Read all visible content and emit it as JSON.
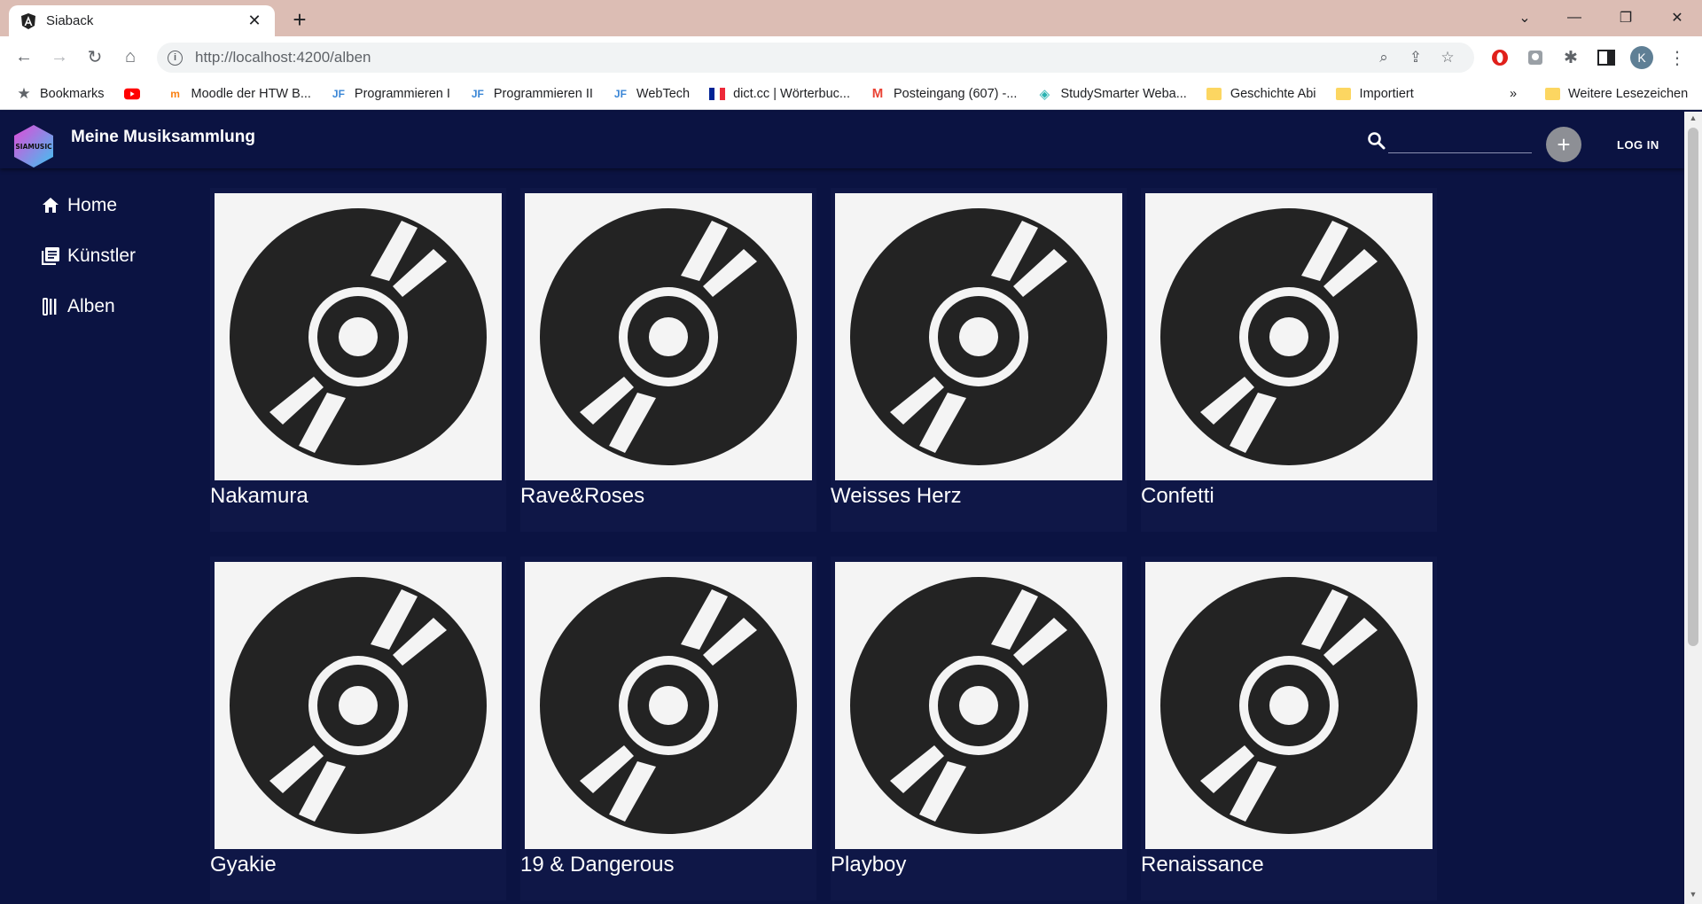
{
  "browser": {
    "tab_title": "Siaback",
    "url": "http://localhost:4200/alben",
    "profile_initial": "K",
    "bookmarks": [
      {
        "label": "Bookmarks",
        "icon": "star-icon"
      },
      {
        "label": "",
        "icon": "youtube-icon"
      },
      {
        "label": "Moodle der HTW B...",
        "icon": "moodle-icon"
      },
      {
        "label": "Programmieren I",
        "icon": "jf-icon"
      },
      {
        "label": "Programmieren II",
        "icon": "jf-icon"
      },
      {
        "label": "WebTech",
        "icon": "jf-icon"
      },
      {
        "label": "dict.cc | Wörterbuc...",
        "icon": "flag-icon"
      },
      {
        "label": "Posteingang (607) -...",
        "icon": "gmail-icon"
      },
      {
        "label": "StudySmarter Weba...",
        "icon": "studysmarter-icon"
      },
      {
        "label": "Geschichte Abi",
        "icon": "folder-icon"
      },
      {
        "label": "Importiert",
        "icon": "folder-icon"
      }
    ],
    "overflow": "»",
    "other_bookmarks": "Weitere Lesezeichen"
  },
  "app": {
    "title": "Meine Musiksammlung",
    "logo_text": "SIAMUSIC",
    "search_placeholder": "",
    "add_label": "+",
    "login_label": "LOG IN"
  },
  "nav": [
    {
      "label": "Home",
      "icon": "home-icon"
    },
    {
      "label": "Künstler",
      "icon": "library-icon"
    },
    {
      "label": "Alben",
      "icon": "album-icon"
    }
  ],
  "albums": [
    {
      "name": "Nakamura"
    },
    {
      "name": "Rave&Roses"
    },
    {
      "name": "Weisses Herz"
    },
    {
      "name": "Confetti"
    },
    {
      "name": "Gyakie"
    },
    {
      "name": "19 & Dangerous"
    },
    {
      "name": "Playboy"
    },
    {
      "name": "Renaissance"
    }
  ],
  "colors": {
    "app_background": "#0b1342",
    "tabstrip": "#dcbdb4",
    "disc": "#232323",
    "cover_background": "#f4f4f4"
  }
}
